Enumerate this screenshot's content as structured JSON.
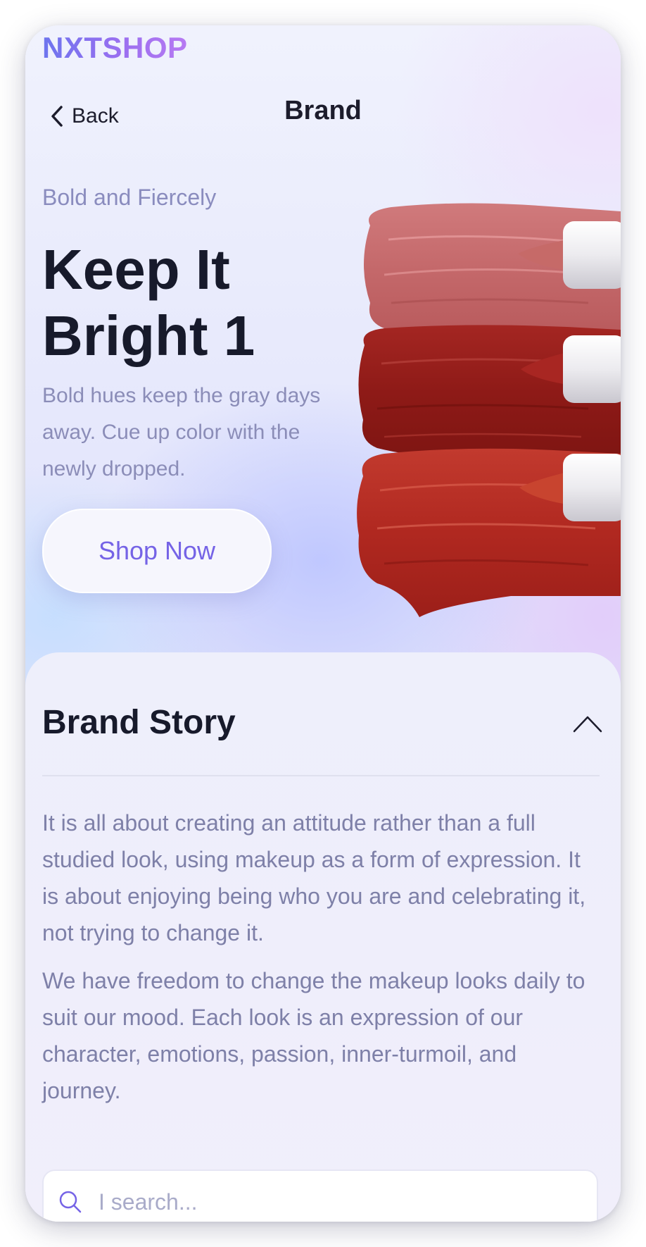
{
  "app": {
    "logo": "NXTSHOP",
    "brand_gradient": [
      "#6d74ee",
      "#b77af2"
    ]
  },
  "topbar": {
    "back_label": "Back",
    "back_icon": "chevron-left-icon",
    "title": "Brand"
  },
  "hero": {
    "eyebrow": "Bold and Fiercely",
    "headline": "Keep It Bright 1",
    "description": "Bold hues keep the gray days away. Cue up color with the newly dropped.",
    "cta_label": "Shop Now",
    "cta_color": "#7563e6",
    "image": "lipstick-swatches",
    "swatch_colors": [
      "#c4686a",
      "#9a1e1a",
      "#b62a22"
    ]
  },
  "brand_story": {
    "title": "Brand Story",
    "toggle_icon": "chevron-up-icon",
    "expanded": true,
    "paragraphs": [
      "It is all about creating an attitude rather than a full studied look, using makeup as a form of expression. It is about enjoying being who you are and celebrating it, not trying to change it.",
      "We have freedom to change the makeup looks daily to suit our mood. Each look is an expression of our character, emotions, passion, inner-turmoil, and journey."
    ]
  },
  "search": {
    "placeholder": "I search...",
    "value": "",
    "icon": "search-icon"
  }
}
